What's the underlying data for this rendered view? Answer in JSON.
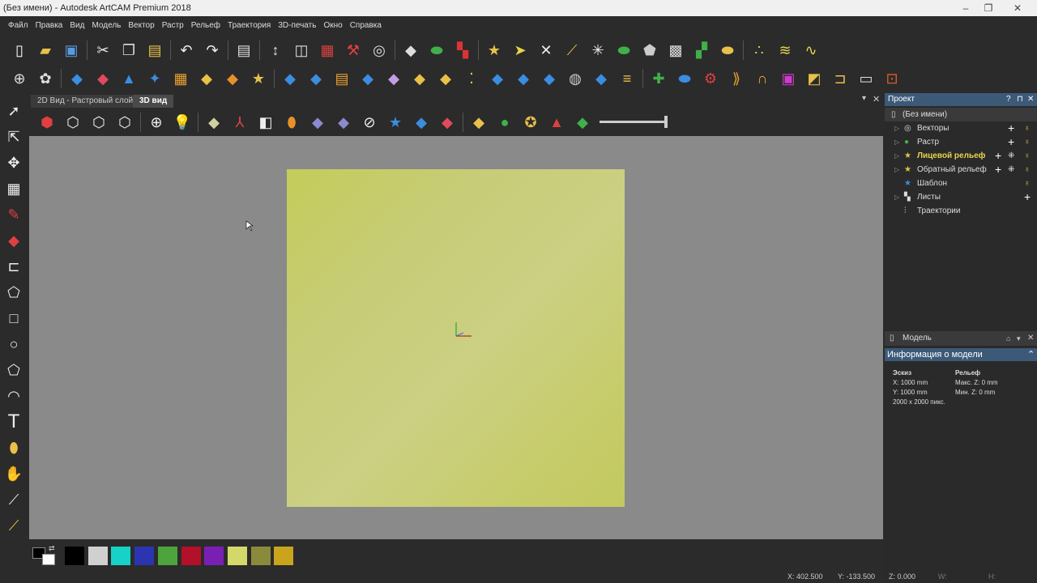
{
  "window": {
    "title": "(Без имени) - Autodesk ArtCAM Premium 2018",
    "minimize_icon": "minimize-icon",
    "maximize_icon": "maximize-icon",
    "close_icon": "close-icon"
  },
  "menu": [
    "Файл",
    "Правка",
    "Вид",
    "Модель",
    "Вектор",
    "Растр",
    "Рельеф",
    "Траектория",
    "3D-печать",
    "Окно",
    "Справка"
  ],
  "tabs": {
    "tab_2d": "2D Вид - Растровый слой",
    "tab_3d": "3D вид",
    "active": "3D вид"
  },
  "project_panel": {
    "title": "Проект",
    "root": "(Без имени)",
    "items": [
      {
        "label": "Векторы",
        "highlight": false
      },
      {
        "label": "Растр",
        "highlight": false
      },
      {
        "label": "Лицевой рельеф",
        "highlight": true
      },
      {
        "label": "Обратный рельеф",
        "highlight": false
      },
      {
        "label": "Шаблон",
        "highlight": false
      },
      {
        "label": "Листы",
        "highlight": false
      },
      {
        "label": "Траектории",
        "highlight": false
      }
    ]
  },
  "model_panel": {
    "title": "Модель",
    "info_title": "Информация о модели",
    "sketch_header": "Эскиз",
    "sketch_x": "X: 1000 mm",
    "sketch_y": "Y: 1000 mm",
    "sketch_px": "2000 x 2000 пикс.",
    "relief_header": "Рельеф",
    "relief_max": "Макс. Z: 0 mm",
    "relief_min": "Мин. Z: 0 mm"
  },
  "palette": [
    "#000000",
    "#d0d0d0",
    "#17d2c6",
    "#2b35b0",
    "#4ea43c",
    "#b3102a",
    "#7a1fb4",
    "#d4d86a",
    "#8b8a3c",
    "#c9a41c"
  ],
  "status": {
    "x": "X: 402.500",
    "y": "Y: -133.500",
    "z": "Z: 0.000",
    "w": "W:",
    "h": "H:"
  },
  "colors": {
    "accent": "#3c5a78",
    "highlight_text": "#e8d44d",
    "viewport_bg": "#8a8a8a",
    "plate": "#c8cd6b"
  }
}
